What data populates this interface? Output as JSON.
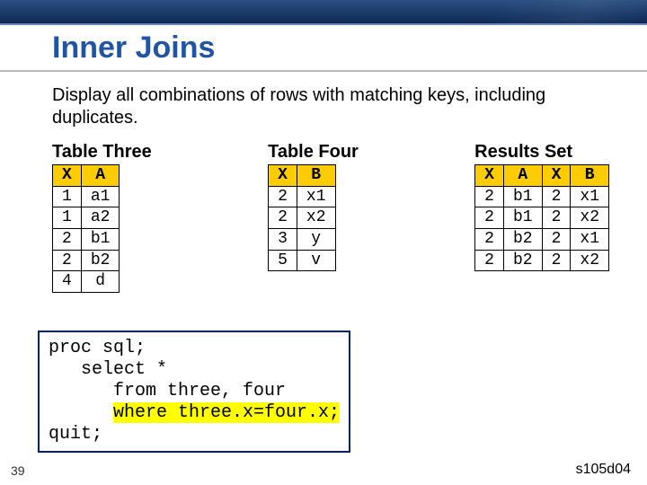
{
  "slide": {
    "title": "Inner Joins",
    "description": "Display all combinations of rows with matching keys, including duplicates.",
    "footer_number": "39",
    "footer_code": "s105d04"
  },
  "tables": {
    "three": {
      "caption": "Table Three",
      "headers": [
        "X",
        "A"
      ],
      "rows": [
        [
          "1",
          "a1"
        ],
        [
          "1",
          "a2"
        ],
        [
          "2",
          "b1"
        ],
        [
          "2",
          "b2"
        ],
        [
          "4",
          "d"
        ]
      ]
    },
    "four": {
      "caption": "Table Four",
      "headers": [
        "X",
        "B"
      ],
      "rows": [
        [
          "2",
          "x1"
        ],
        [
          "2",
          "x2"
        ],
        [
          "3",
          "y"
        ],
        [
          "5",
          "v"
        ]
      ]
    },
    "results": {
      "caption": "Results Set",
      "headers": [
        "X",
        "A",
        "X",
        "B"
      ],
      "rows": [
        [
          "2",
          "b1",
          "2",
          "x1"
        ],
        [
          "2",
          "b1",
          "2",
          "x2"
        ],
        [
          "2",
          "b2",
          "2",
          "x1"
        ],
        [
          "2",
          "b2",
          "2",
          "x2"
        ]
      ]
    }
  },
  "code": {
    "line1": "proc sql;",
    "line2": "   select *",
    "line3": "      from three, four",
    "line4pre": "      ",
    "line4hl": "where three.x=four.x;",
    "line5": "quit;"
  }
}
